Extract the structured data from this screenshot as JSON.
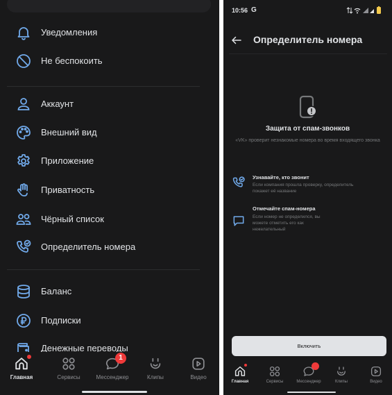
{
  "left_screen": {
    "menu": [
      {
        "label": "Уведомления",
        "icon": "bell-icon"
      },
      {
        "label": "Не беспокоить",
        "icon": "do-not-disturb-icon"
      },
      {
        "label": "Аккаунт",
        "icon": "user-icon"
      },
      {
        "label": "Внешний вид",
        "icon": "palette-icon"
      },
      {
        "label": "Приложение",
        "icon": "gear-icon"
      },
      {
        "label": "Приватность",
        "icon": "hand-icon"
      },
      {
        "label": "Чёрный список",
        "icon": "users-icon"
      },
      {
        "label": "Определитель номера",
        "icon": "phone-check-icon"
      },
      {
        "label": "Баланс",
        "icon": "database-icon"
      },
      {
        "label": "Подписки",
        "icon": "ruble-circle-icon"
      },
      {
        "label": "Денежные переводы",
        "icon": "wallet-icon"
      }
    ],
    "tabs": [
      {
        "label": "Главная",
        "icon": "home-icon",
        "active": true
      },
      {
        "label": "Сервисы",
        "icon": "services-icon"
      },
      {
        "label": "Мессенджер",
        "icon": "message-icon",
        "badge": "1"
      },
      {
        "label": "Клипы",
        "icon": "clips-icon"
      },
      {
        "label": "Видео",
        "icon": "video-icon"
      }
    ]
  },
  "right_screen": {
    "status": {
      "time": "10:56",
      "g": "G"
    },
    "header": {
      "title": "Определитель номера"
    },
    "promo": {
      "title": "Защита от спам-звонков",
      "subtitle": "«VK» проверит незнакомые номера во время входящего звонка"
    },
    "features": [
      {
        "title": "Узнавайте, кто звонит",
        "desc": "Если компания прошла проверку, определитель покажет её название",
        "icon": "phone-check-icon"
      },
      {
        "title": "Отмечайте спам-номера",
        "desc": "Если номер не определился, вы можете отметить его как нежелательный",
        "icon": "message-square-icon"
      }
    ],
    "button": "Включить",
    "tabs": [
      {
        "label": "Главная",
        "icon": "home-icon",
        "active": true
      },
      {
        "label": "Сервисы",
        "icon": "services-icon"
      },
      {
        "label": "Мессенджер",
        "icon": "message-icon",
        "badge": ""
      },
      {
        "label": "Клипы",
        "icon": "clips-icon"
      },
      {
        "label": "Видео",
        "icon": "video-icon"
      }
    ]
  },
  "colors": {
    "accent": "#447bba",
    "icon_blue": "#71aaeb",
    "badge": "#ef3a3a",
    "bg": "#19191a",
    "text": "#e1e3e6",
    "muted": "#76787a"
  }
}
